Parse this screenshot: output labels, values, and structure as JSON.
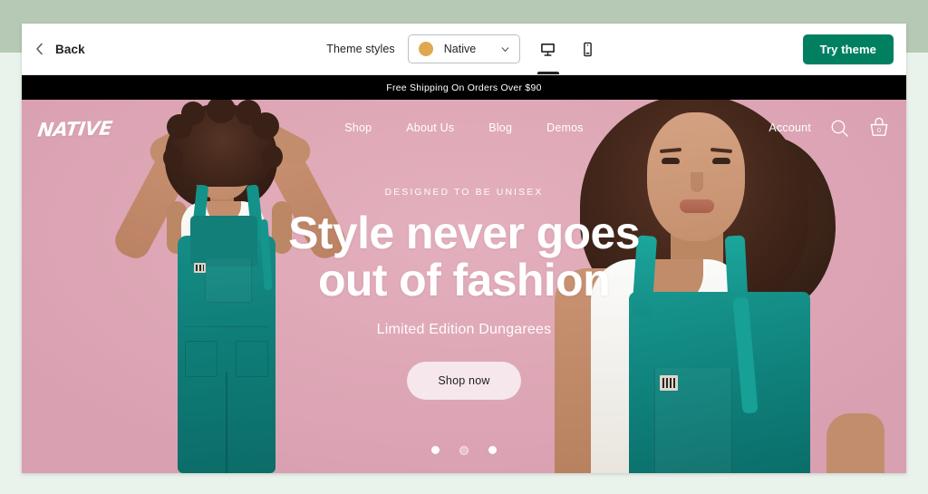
{
  "toolbar": {
    "back_label": "Back",
    "back_icon": "chevron-left-icon",
    "theme_styles_label": "Theme styles",
    "style_select": {
      "value": "Native",
      "swatch_color": "#E0A84E",
      "chevron_icon": "chevron-down-icon"
    },
    "view_toggles": [
      {
        "name": "desktop-view",
        "icon": "desktop-icon",
        "active": true
      },
      {
        "name": "mobile-view",
        "icon": "mobile-icon",
        "active": false
      }
    ],
    "try_theme_label": "Try theme",
    "try_theme_color": "#008060"
  },
  "storefront": {
    "announcement": "Free Shipping On Orders Over $90",
    "announcement_bg": "#000000",
    "logo": "NATIVE",
    "nav": [
      {
        "label": "Shop"
      },
      {
        "label": "About Us"
      },
      {
        "label": "Blog"
      },
      {
        "label": "Demos"
      }
    ],
    "actions": {
      "account_label": "Account",
      "search_icon": "search-icon",
      "cart_icon": "shopping-basket-icon",
      "cart_count": "0"
    },
    "hero": {
      "eyebrow": "DESIGNED TO BE UNISEX",
      "title_line1": "Style never goes",
      "title_line2": "out of fashion",
      "subtitle": "Limited Edition Dungarees",
      "cta_label": "Shop now",
      "background_color": "#E0A9B8",
      "garment_color": "#0F817B"
    },
    "carousel": {
      "slides": 3,
      "active_index": 1
    }
  },
  "page": {
    "background_color": "#E9F2EB",
    "band_color": "#B6C9B4"
  }
}
